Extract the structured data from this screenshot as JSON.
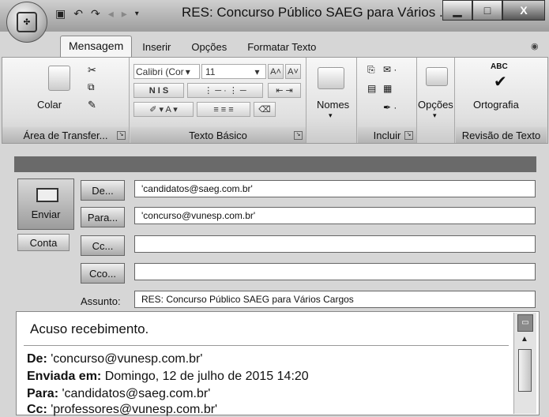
{
  "window": {
    "title": "RES: Concurso Público SAEG para Vários ...",
    "controls": {
      "minimize": "▁",
      "maximize": "□",
      "close": "X"
    }
  },
  "qat": {
    "icons": [
      "save-icon",
      "undo-icon",
      "redo-icon",
      "prev-icon",
      "next-icon",
      "dropdown-icon"
    ]
  },
  "tabs": [
    "Mensagem",
    "Inserir",
    "Opções",
    "Formatar Texto"
  ],
  "ribbon": {
    "clipboard": {
      "paste": "Colar",
      "group": "Área de Transfer..."
    },
    "basic_text": {
      "font": "Calibri (Cor",
      "size": "11",
      "group": "Texto Básico"
    },
    "names": {
      "label": "Nomes",
      "arrow": "▾"
    },
    "include": {
      "group": "Incluir"
    },
    "options": {
      "label": "Opções",
      "arrow": "▾"
    },
    "proofing": {
      "label": "Ortografia",
      "icon_text": "ABC",
      "group": "Revisão de Texto"
    }
  },
  "compose": {
    "send_label": "Enviar",
    "account_label": "Conta",
    "from_btn": "De...",
    "from_value": "'candidatos@saeg.com.br'",
    "to_btn": "Para...",
    "to_value": "'concurso@vunesp.com.br'",
    "cc_btn": "Cc...",
    "cc_value": "",
    "bcc_btn": "Cco...",
    "bcc_value": "",
    "subject_label": "Assunto:",
    "subject_value": "RES: Concurso Público SAEG para Vários Cargos"
  },
  "body": {
    "first_line": "Acuso recebimento.",
    "from_label": "De:",
    "from_value": " 'concurso@vunesp.com.br'",
    "sent_label": "Enviada em:",
    "sent_value": " Domingo, 12 de julho de 2015  14:20",
    "to_label": "Para:",
    "to_value": " 'candidatos@saeg.com.br'",
    "cc_label": "Cc:",
    "cc_value": " 'professores@vunesp.com.br'"
  }
}
